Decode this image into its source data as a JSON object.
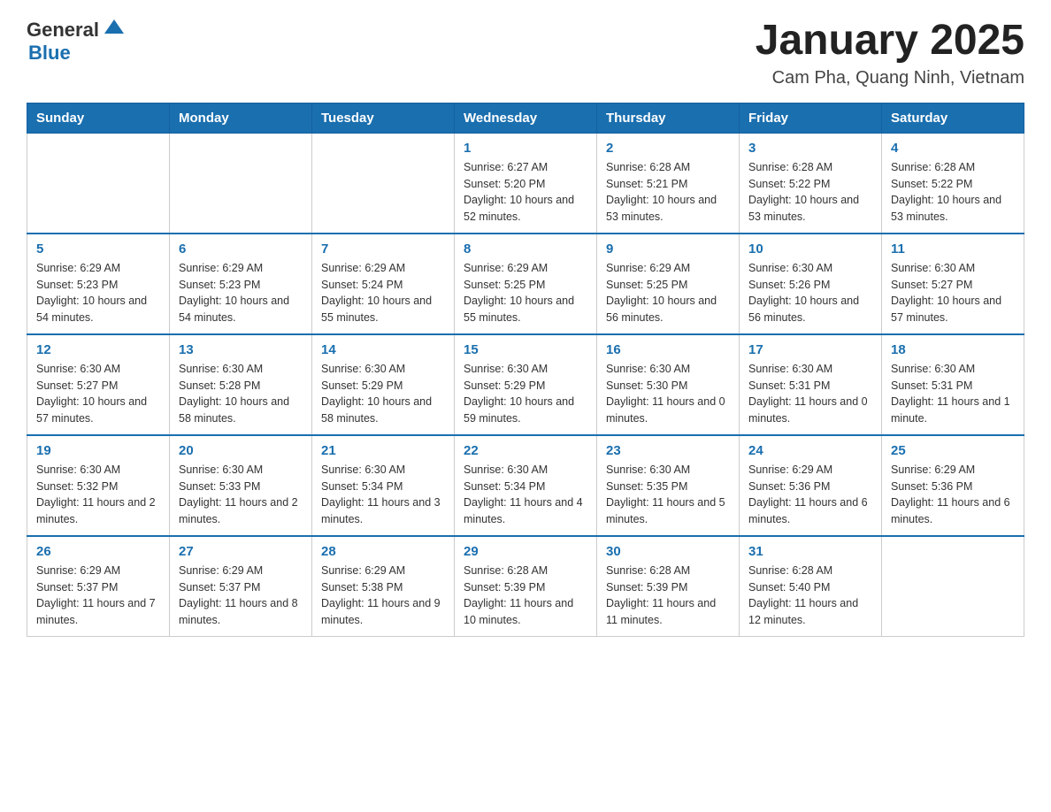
{
  "header": {
    "logo_general": "General",
    "logo_blue": "Blue",
    "title": "January 2025",
    "subtitle": "Cam Pha, Quang Ninh, Vietnam"
  },
  "days_of_week": [
    "Sunday",
    "Monday",
    "Tuesday",
    "Wednesday",
    "Thursday",
    "Friday",
    "Saturday"
  ],
  "weeks": [
    [
      {
        "day": "",
        "info": ""
      },
      {
        "day": "",
        "info": ""
      },
      {
        "day": "",
        "info": ""
      },
      {
        "day": "1",
        "info": "Sunrise: 6:27 AM\nSunset: 5:20 PM\nDaylight: 10 hours and 52 minutes."
      },
      {
        "day": "2",
        "info": "Sunrise: 6:28 AM\nSunset: 5:21 PM\nDaylight: 10 hours and 53 minutes."
      },
      {
        "day": "3",
        "info": "Sunrise: 6:28 AM\nSunset: 5:22 PM\nDaylight: 10 hours and 53 minutes."
      },
      {
        "day": "4",
        "info": "Sunrise: 6:28 AM\nSunset: 5:22 PM\nDaylight: 10 hours and 53 minutes."
      }
    ],
    [
      {
        "day": "5",
        "info": "Sunrise: 6:29 AM\nSunset: 5:23 PM\nDaylight: 10 hours and 54 minutes."
      },
      {
        "day": "6",
        "info": "Sunrise: 6:29 AM\nSunset: 5:23 PM\nDaylight: 10 hours and 54 minutes."
      },
      {
        "day": "7",
        "info": "Sunrise: 6:29 AM\nSunset: 5:24 PM\nDaylight: 10 hours and 55 minutes."
      },
      {
        "day": "8",
        "info": "Sunrise: 6:29 AM\nSunset: 5:25 PM\nDaylight: 10 hours and 55 minutes."
      },
      {
        "day": "9",
        "info": "Sunrise: 6:29 AM\nSunset: 5:25 PM\nDaylight: 10 hours and 56 minutes."
      },
      {
        "day": "10",
        "info": "Sunrise: 6:30 AM\nSunset: 5:26 PM\nDaylight: 10 hours and 56 minutes."
      },
      {
        "day": "11",
        "info": "Sunrise: 6:30 AM\nSunset: 5:27 PM\nDaylight: 10 hours and 57 minutes."
      }
    ],
    [
      {
        "day": "12",
        "info": "Sunrise: 6:30 AM\nSunset: 5:27 PM\nDaylight: 10 hours and 57 minutes."
      },
      {
        "day": "13",
        "info": "Sunrise: 6:30 AM\nSunset: 5:28 PM\nDaylight: 10 hours and 58 minutes."
      },
      {
        "day": "14",
        "info": "Sunrise: 6:30 AM\nSunset: 5:29 PM\nDaylight: 10 hours and 58 minutes."
      },
      {
        "day": "15",
        "info": "Sunrise: 6:30 AM\nSunset: 5:29 PM\nDaylight: 10 hours and 59 minutes."
      },
      {
        "day": "16",
        "info": "Sunrise: 6:30 AM\nSunset: 5:30 PM\nDaylight: 11 hours and 0 minutes."
      },
      {
        "day": "17",
        "info": "Sunrise: 6:30 AM\nSunset: 5:31 PM\nDaylight: 11 hours and 0 minutes."
      },
      {
        "day": "18",
        "info": "Sunrise: 6:30 AM\nSunset: 5:31 PM\nDaylight: 11 hours and 1 minute."
      }
    ],
    [
      {
        "day": "19",
        "info": "Sunrise: 6:30 AM\nSunset: 5:32 PM\nDaylight: 11 hours and 2 minutes."
      },
      {
        "day": "20",
        "info": "Sunrise: 6:30 AM\nSunset: 5:33 PM\nDaylight: 11 hours and 2 minutes."
      },
      {
        "day": "21",
        "info": "Sunrise: 6:30 AM\nSunset: 5:34 PM\nDaylight: 11 hours and 3 minutes."
      },
      {
        "day": "22",
        "info": "Sunrise: 6:30 AM\nSunset: 5:34 PM\nDaylight: 11 hours and 4 minutes."
      },
      {
        "day": "23",
        "info": "Sunrise: 6:30 AM\nSunset: 5:35 PM\nDaylight: 11 hours and 5 minutes."
      },
      {
        "day": "24",
        "info": "Sunrise: 6:29 AM\nSunset: 5:36 PM\nDaylight: 11 hours and 6 minutes."
      },
      {
        "day": "25",
        "info": "Sunrise: 6:29 AM\nSunset: 5:36 PM\nDaylight: 11 hours and 6 minutes."
      }
    ],
    [
      {
        "day": "26",
        "info": "Sunrise: 6:29 AM\nSunset: 5:37 PM\nDaylight: 11 hours and 7 minutes."
      },
      {
        "day": "27",
        "info": "Sunrise: 6:29 AM\nSunset: 5:37 PM\nDaylight: 11 hours and 8 minutes."
      },
      {
        "day": "28",
        "info": "Sunrise: 6:29 AM\nSunset: 5:38 PM\nDaylight: 11 hours and 9 minutes."
      },
      {
        "day": "29",
        "info": "Sunrise: 6:28 AM\nSunset: 5:39 PM\nDaylight: 11 hours and 10 minutes."
      },
      {
        "day": "30",
        "info": "Sunrise: 6:28 AM\nSunset: 5:39 PM\nDaylight: 11 hours and 11 minutes."
      },
      {
        "day": "31",
        "info": "Sunrise: 6:28 AM\nSunset: 5:40 PM\nDaylight: 11 hours and 12 minutes."
      },
      {
        "day": "",
        "info": ""
      }
    ]
  ]
}
